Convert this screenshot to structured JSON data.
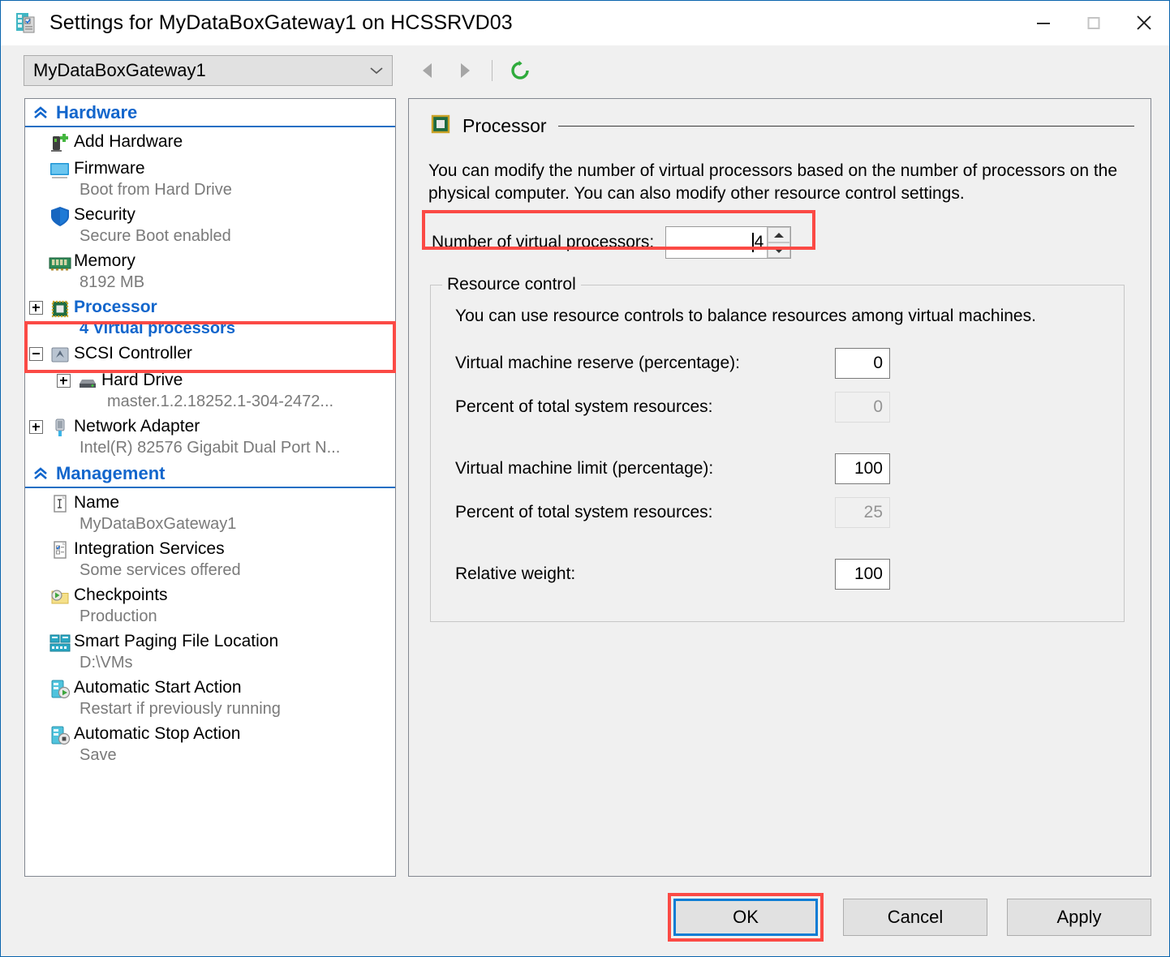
{
  "window": {
    "title": "Settings for MyDataBoxGateway1 on HCSSRVD03",
    "app_icon": "vm-settings-icon",
    "controls": {
      "minimize": "minimize-icon",
      "maximize": "maximize-icon",
      "close": "close-icon"
    },
    "accent_blue": "#0a64ad",
    "highlight_red": "#fb4a45"
  },
  "toolbar": {
    "vm_selector_value": "MyDataBoxGateway1",
    "back_icon": "back-arrow-icon",
    "forward_icon": "forward-arrow-icon",
    "refresh_icon": "refresh-icon"
  },
  "sidebar": {
    "sections": [
      {
        "title": "Hardware",
        "items": [
          {
            "label": "Add Hardware",
            "sub": "",
            "icon": "add-hardware-icon",
            "expander": "none",
            "indent": 0,
            "selected": false
          },
          {
            "label": "Firmware",
            "sub": "Boot from Hard Drive",
            "icon": "firmware-icon",
            "expander": "none",
            "indent": 0,
            "selected": false
          },
          {
            "label": "Security",
            "sub": "Secure Boot enabled",
            "icon": "security-shield-icon",
            "expander": "none",
            "indent": 0,
            "selected": false
          },
          {
            "label": "Memory",
            "sub": "8192 MB",
            "icon": "memory-icon",
            "expander": "none",
            "indent": 0,
            "selected": false
          },
          {
            "label": "Processor",
            "sub": "4 Virtual processors",
            "icon": "processor-icon",
            "expander": "plus",
            "indent": 0,
            "selected": true
          },
          {
            "label": "SCSI Controller",
            "sub": "",
            "icon": "scsi-controller-icon",
            "expander": "minus",
            "indent": 0,
            "selected": false
          },
          {
            "label": "Hard Drive",
            "sub": "master.1.2.18252.1-304-2472...",
            "icon": "hard-drive-icon",
            "expander": "plus",
            "indent": 1,
            "selected": false
          },
          {
            "label": "Network Adapter",
            "sub": "Intel(R) 82576 Gigabit Dual Port N...",
            "icon": "network-adapter-icon",
            "expander": "plus",
            "indent": 0,
            "selected": false
          }
        ]
      },
      {
        "title": "Management",
        "items": [
          {
            "label": "Name",
            "sub": "MyDataBoxGateway1",
            "icon": "name-icon",
            "expander": "none",
            "indent": 0,
            "selected": false
          },
          {
            "label": "Integration Services",
            "sub": "Some services offered",
            "icon": "integration-services-icon",
            "expander": "none",
            "indent": 0,
            "selected": false
          },
          {
            "label": "Checkpoints",
            "sub": "Production",
            "icon": "checkpoints-icon",
            "expander": "none",
            "indent": 0,
            "selected": false
          },
          {
            "label": "Smart Paging File Location",
            "sub": "D:\\VMs",
            "icon": "smart-paging-icon",
            "expander": "none",
            "indent": 0,
            "selected": false
          },
          {
            "label": "Automatic Start Action",
            "sub": "Restart if previously running",
            "icon": "auto-start-icon",
            "expander": "none",
            "indent": 0,
            "selected": false
          },
          {
            "label": "Automatic Stop Action",
            "sub": "Save",
            "icon": "auto-stop-icon",
            "expander": "none",
            "indent": 0,
            "selected": false
          }
        ]
      }
    ]
  },
  "main": {
    "header_title": "Processor",
    "header_icon": "processor-icon",
    "description": "You can modify the number of virtual processors based on the number of processors on the physical computer. You can also modify other resource control settings.",
    "virtual_processors": {
      "label": "Number of virtual processors:",
      "value": "4"
    },
    "resource_control": {
      "legend": "Resource control",
      "description": "You can use resource controls to balance resources among virtual machines.",
      "fields": [
        {
          "label": "Virtual machine reserve (percentage):",
          "value": "0",
          "readonly": false
        },
        {
          "label": "Percent of total system resources:",
          "value": "0",
          "readonly": true
        },
        {
          "label": "Virtual machine limit (percentage):",
          "value": "100",
          "readonly": false
        },
        {
          "label": "Percent of total system resources:",
          "value": "25",
          "readonly": true
        },
        {
          "label": "Relative weight:",
          "value": "100",
          "readonly": false
        }
      ]
    }
  },
  "footer": {
    "ok_label": "OK",
    "cancel_label": "Cancel",
    "apply_label": "Apply"
  }
}
